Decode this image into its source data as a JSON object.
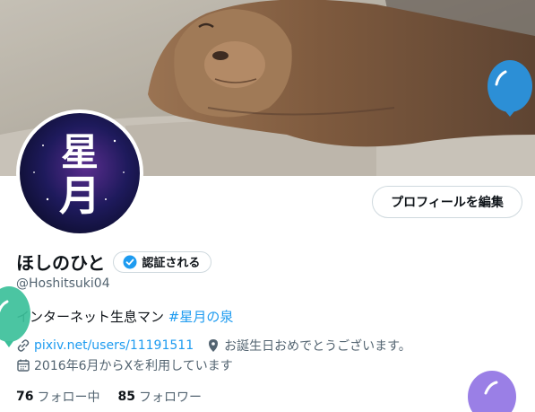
{
  "profile": {
    "display_name": "ほしのひと",
    "handle": "@Hoshitsuki04",
    "bio_text": "インターネット生息マン ",
    "bio_hashtag": "#星月の泉",
    "website": "pixiv.net/users/11191511",
    "birthday": "お誕生日おめでとうございます。",
    "joined": "2016年6月からXを利用しています",
    "following_count": "76",
    "following_label": "フォロー中",
    "followers_count": "85",
    "followers_label": "フォロワー",
    "avatar_text": "星月"
  },
  "buttons": {
    "edit_profile": "プロフィールを編集",
    "verify": "認証される"
  },
  "colors": {
    "accent": "#1d9bf0",
    "secondary_text": "#536471",
    "balloon_blue": "#2c8fd6",
    "balloon_teal": "#3cc09a",
    "balloon_purple": "#9a7fe6"
  },
  "icons": [
    "link-icon",
    "location-icon",
    "calendar-icon",
    "verified-badge-icon",
    "balloon-icon"
  ]
}
